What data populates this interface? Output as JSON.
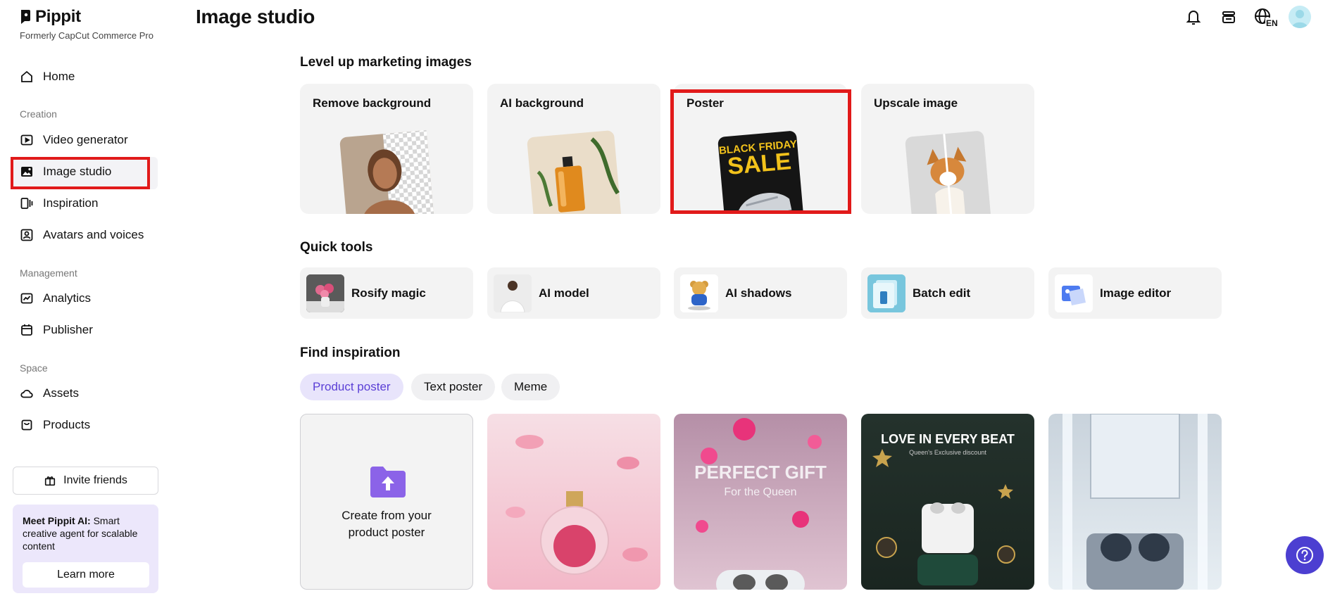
{
  "brand": {
    "name": "Pippit",
    "subtitle": "Formerly CapCut Commerce Pro"
  },
  "sidebar": {
    "home": "Home",
    "sections": {
      "creation": "Creation",
      "management": "Management",
      "space": "Space"
    },
    "items": {
      "video_generator": "Video generator",
      "image_studio": "Image studio",
      "inspiration": "Inspiration",
      "avatars_voices": "Avatars and voices",
      "analytics": "Analytics",
      "publisher": "Publisher",
      "assets": "Assets",
      "products": "Products"
    },
    "invite": "Invite friends",
    "promo": {
      "bold": "Meet Pippit AI:",
      "text": " Smart creative agent for scalable content",
      "button": "Learn more"
    }
  },
  "header": {
    "title": "Image studio",
    "language": "EN"
  },
  "marketing": {
    "title": "Level up marketing images",
    "cards": [
      "Remove background",
      "AI background",
      "Poster",
      "Upscale image"
    ],
    "poster_art": {
      "line1": "BLACK FRIDAY",
      "line2": "SALE"
    }
  },
  "quick_tools": {
    "title": "Quick tools",
    "items": [
      "Rosify magic",
      "AI model",
      "AI shadows",
      "Batch edit",
      "Image editor"
    ]
  },
  "inspiration": {
    "title": "Find inspiration",
    "chips": [
      "Product poster",
      "Text poster",
      "Meme"
    ],
    "create_text_1": "Create from your",
    "create_text_2": "product poster",
    "cards": [
      {
        "line1": "",
        "line2": ""
      },
      {
        "line1": "PERFECT GIFT",
        "line2": "For the Queen"
      },
      {
        "line1": "LOVE IN EVERY BEAT",
        "line2": "Queen's Exclusive discount"
      },
      {
        "line1": "",
        "line2": ""
      }
    ]
  },
  "colors": {
    "accent": "#5b3fd6",
    "highlight": "#e11a1a",
    "chip_active_bg": "#e8e4fb",
    "card_bg": "#f3f3f3"
  }
}
